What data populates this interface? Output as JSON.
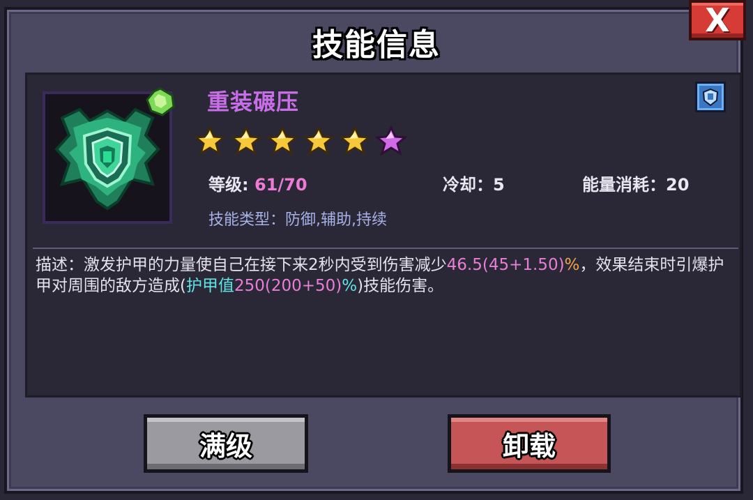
{
  "dialog": {
    "title": "技能信息",
    "close_label": "X"
  },
  "skill": {
    "name": "重装碾压",
    "icon": "shield-armor-icon",
    "gem_icon": "green-gem-icon",
    "badge_icon": "blue-shield-badge-icon",
    "stars_total": 6,
    "stars_gold": 5,
    "stars_purple": 1,
    "level_label": "等级:",
    "level_value": "61/70",
    "cooldown_label": "冷却：",
    "cooldown_value": "5",
    "energy_label": "能量消耗：",
    "energy_value": "20",
    "type_line": "技能类型：防御,辅助,持续"
  },
  "description": {
    "p1": "描述：激发护甲的力量使自己在接下来2秒内受到伤害减少",
    "h1": "46.5(45+1.50)",
    "h1_pct": "%",
    "p2": "，效果结束时引爆护甲对周围的敌方造成(",
    "h2": "护甲值",
    "h3": "250(200+50)",
    "h3_pct": "%",
    "p3": ")技能伤害。"
  },
  "buttons": {
    "max_label": "满级",
    "unload_label": "卸载"
  },
  "colors": {
    "panel": "#4b4862",
    "content": "#2a2836",
    "name": "#c86ee6",
    "star_gold": "#f6c83a",
    "star_purple": "#d06ae8",
    "highlight_pink": "#e87fd6",
    "highlight_orange": "#f0a44a",
    "highlight_cyan": "#5fe4e8"
  }
}
